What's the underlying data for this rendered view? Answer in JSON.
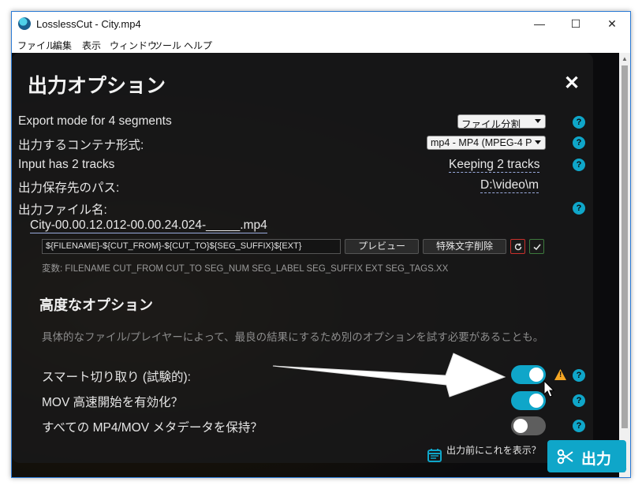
{
  "window": {
    "title": "LosslessCut - City.mp4",
    "minimize_symbol": "—",
    "maximize_symbol": "☐",
    "close_symbol": "✕"
  },
  "menu": [
    "ファイル",
    "編集",
    "表示",
    "ウィンドウ",
    "ツール",
    "ヘルプ"
  ],
  "dialog": {
    "title": "出力オプション",
    "close_symbol": "✕",
    "rows": {
      "export_mode_label": "Export mode for 4 segments",
      "export_mode_value": "ファイル分割",
      "container_label": "出力するコンテナ形式:",
      "container_value": "mp4 - MP4 (MPEG-4 P",
      "tracks_label": "Input has 2 tracks",
      "tracks_value": "Keeping 2 tracks",
      "output_path_label": "出力保存先のパス:",
      "output_path_value": "D:\\video\\m",
      "output_name_label": "出力ファイル名:"
    },
    "filename_preview": "City-00.00.12.012-00.00.24.024-_____.mp4",
    "template_value": "${FILENAME}-${CUT_FROM}-${CUT_TO}${SEG_SUFFIX}${EXT}",
    "preview_button": "プレビュー",
    "remove_special_button": "特殊文字削除",
    "variables_text": "変数: FILENAME CUT_FROM CUT_TO SEG_NUM SEG_LABEL SEG_SUFFIX EXT SEG_TAGS.XX",
    "advanced_title": "高度なオプション",
    "advanced_desc": "具体的なファイル/プレイヤーによって、最良の結果にするため別のオプションを試す必要があることも。",
    "smart_cut_label": "スマート切り取り (試験的):",
    "smart_cut_on": true,
    "mov_faststart_label": "MOV 高速開始を有効化？",
    "mov_faststart_on": true,
    "preserve_metadata_label": "すべての MP4/MOV メタデータを保持？",
    "preserve_metadata_on": false,
    "help_symbol": "?",
    "warning_symbol": "!",
    "show_before_export": "出力前にこれを表示？",
    "export_button": "出力"
  },
  "colors": {
    "accent": "#0fa6c9",
    "warning": "#f5a623",
    "reset": "#c9302c",
    "confirm": "#3d7a3d"
  },
  "icons": {
    "app": "losslesscut-app-icon",
    "close": "close-icon",
    "help": "help-icon",
    "warning": "warning-icon",
    "reset": "reset-icon",
    "confirm": "check-icon",
    "calendar": "calendar-icon",
    "scissors": "scissors-icon"
  }
}
